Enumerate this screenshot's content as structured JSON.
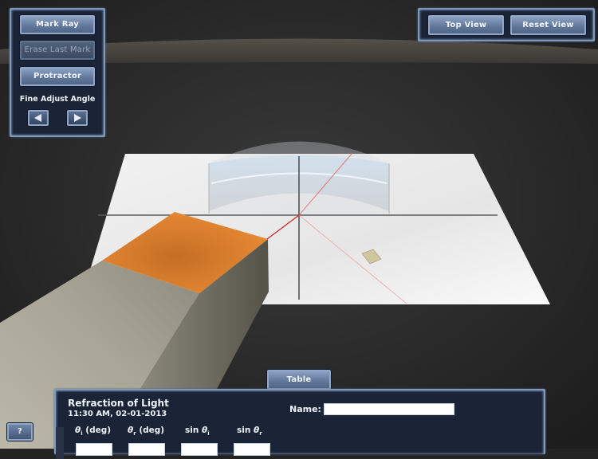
{
  "left_panel": {
    "mark_ray_label": "Mark Ray",
    "erase_last_mark_label": "Erase Last Mark",
    "protractor_label": "Protractor",
    "fine_adjust_label": "Fine Adjust Angle",
    "decrease_icon": "triangle-left-icon",
    "increase_icon": "triangle-right-icon"
  },
  "view_panel": {
    "top_view_label": "Top View",
    "reset_view_label": "Reset View"
  },
  "help_label": "?",
  "table_tab_label": "Table",
  "data_sheet": {
    "title": "Refraction of Light",
    "timestamp": "11:30 AM, 02-01-2013",
    "name_label": "Name:",
    "name_value": "",
    "columns": [
      {
        "sym": "θ",
        "sub": "i",
        "suffix": " (deg)"
      },
      {
        "sym": "θ",
        "sub": "r",
        "suffix": " (deg)"
      },
      {
        "prefix": "sin ",
        "sym": "θ",
        "sub": "i",
        "suffix": ""
      },
      {
        "prefix": "sin ",
        "sym": "θ",
        "sub": "r",
        "suffix": ""
      }
    ],
    "cells": [
      "",
      "",
      "",
      ""
    ]
  },
  "scene": {
    "objects": [
      "paper-sheet",
      "semicircular-lens",
      "laser-box",
      "detector-target"
    ],
    "laser_color": "#d42020",
    "laser_body_color": "#b6b2a4",
    "laser_top_color": "#e0802c"
  }
}
